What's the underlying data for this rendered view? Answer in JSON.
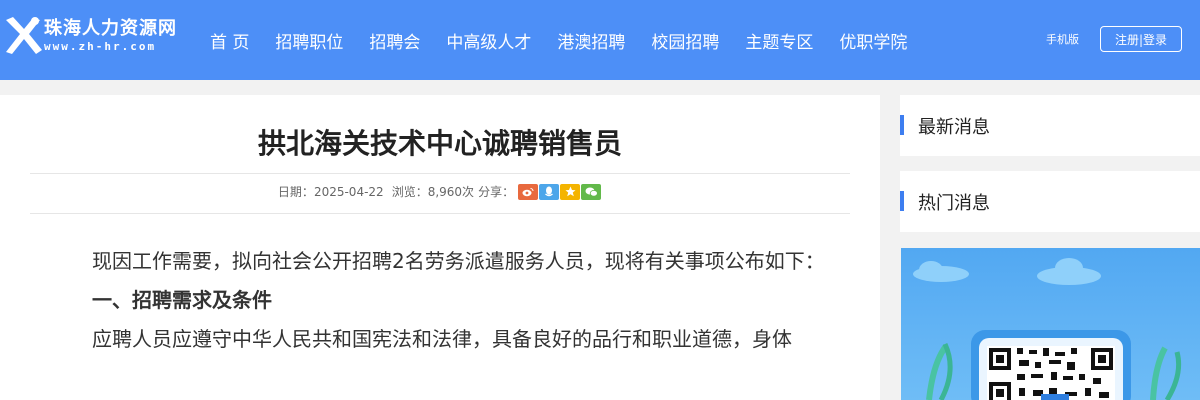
{
  "site": {
    "name": "珠海人力资源网",
    "url_text": "www.zh-hr.com"
  },
  "nav": [
    {
      "label": "首 页"
    },
    {
      "label": "招聘职位"
    },
    {
      "label": "招聘会"
    },
    {
      "label": "中高级人才"
    },
    {
      "label": "港澳招聘"
    },
    {
      "label": "校园招聘"
    },
    {
      "label": "主题专区"
    },
    {
      "label": "优职学院"
    }
  ],
  "header_right": {
    "mobile": "手机版",
    "register_login": "注册|登录"
  },
  "article": {
    "title": "拱北海关技术中心诚聘销售员",
    "date_label": "日期：",
    "date": "2025-04-22",
    "views_label": "浏览：",
    "views": "8,960次",
    "share_label": "分享：",
    "share_icons": [
      "weibo-icon",
      "qq-icon",
      "qzone-icon",
      "wechat-icon"
    ],
    "paragraph1": "现因工作需要，拟向社会公开招聘2名劳务派遣服务人员，现将有关事项公布如下：",
    "heading1": "一、招聘需求及条件",
    "paragraph2": "应聘人员应遵守中华人民共和国宪法和法律，具备良好的品行和职业道德，身体"
  },
  "sidebar": {
    "latest": "最新消息",
    "hot": "热门消息"
  },
  "colors": {
    "header_bg": "#4d8ff7",
    "accent": "#3d7ef0"
  }
}
